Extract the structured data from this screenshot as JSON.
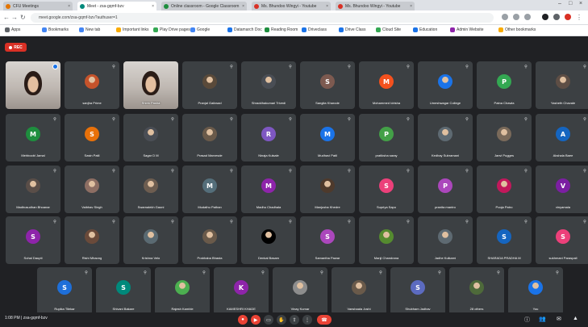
{
  "browser": {
    "tabs": [
      {
        "title": "CFU Meetings",
        "color": "#e37400",
        "active": false
      },
      {
        "title": "Meet - zsa-gqmf-bzv",
        "color": "#00897b",
        "active": true
      },
      {
        "title": "Online classroom - Google Classroom",
        "color": "#1e8e3e",
        "active": false
      },
      {
        "title": "Ms. Bhundoo Wingyi - Youtube",
        "color": "#d93025",
        "active": false
      },
      {
        "title": "Ms. Bhundoo Wingyi - Youtube",
        "color": "#d93025",
        "active": false
      }
    ],
    "url": "meet.google.com/zsa-gqmf-bzv?authuser=1",
    "bookmarks": [
      {
        "label": "Apps",
        "color": "#5f6368"
      },
      {
        "label": "Bookmarks",
        "color": "#4285f4"
      },
      {
        "label": "New tab",
        "color": "#4285f4"
      },
      {
        "label": "Important links",
        "color": "#f9ab00"
      },
      {
        "label": "Play Drive pages",
        "color": "#34a853"
      },
      {
        "label": "Google",
        "color": "#4285f4"
      },
      {
        "label": "Datamarch Doc",
        "color": "#1a73e8"
      },
      {
        "label": "Reading Room",
        "color": "#1e8e3e"
      },
      {
        "label": "Driveclass",
        "color": "#1a73e8"
      },
      {
        "label": "Drive Class",
        "color": "#1a73e8"
      },
      {
        "label": "Cloud Site",
        "color": "#34a853"
      },
      {
        "label": "Education",
        "color": "#1a73e8"
      },
      {
        "label": "Admin Website",
        "color": "#8e24aa"
      },
      {
        "label": "Other bookmarks",
        "color": "#f9ab00"
      }
    ]
  },
  "meet": {
    "recording_label": "REC",
    "participants": [
      {
        "name": "",
        "avatar": "video",
        "avatar_letter": "",
        "avatar_color": "",
        "pinned": true
      },
      {
        "name": "sanjha Prime",
        "avatar": "photo",
        "avatar_letter": "",
        "avatar_color": "#c5532b"
      },
      {
        "name": "Shirin Pasha",
        "avatar": "video",
        "avatar_letter": "",
        "avatar_color": ""
      },
      {
        "name": "Pranjal Gaikwad",
        "avatar": "photo",
        "avatar_letter": "",
        "avatar_color": "#5a4a3a"
      },
      {
        "name": "Shraddhakumari Trivedi",
        "avatar": "photo",
        "avatar_letter": "",
        "avatar_color": "#4a4e55"
      },
      {
        "name": "Sangita Kharode",
        "avatar": "letter",
        "avatar_letter": "S",
        "avatar_color": "#7d5a50"
      },
      {
        "name": "Mohammed Idrisha",
        "avatar": "letter",
        "avatar_letter": "M",
        "avatar_color": "#f4511e"
      },
      {
        "name": "Umeshwagar College",
        "avatar": "photo",
        "avatar_letter": "",
        "avatar_color": "#1a73e8"
      },
      {
        "name": "Patna Chawla",
        "avatar": "letter",
        "avatar_letter": "P",
        "avatar_color": "#33a852"
      },
      {
        "name": "Yasheth Chavale",
        "avatar": "photo",
        "avatar_letter": "",
        "avatar_color": "#5e4e45"
      },
      {
        "name": "Mehboobi Jamal",
        "avatar": "letter",
        "avatar_letter": "M",
        "avatar_color": "#1e8e3e"
      },
      {
        "name": "Sasin Patil",
        "avatar": "letter",
        "avatar_letter": "S",
        "avatar_color": "#e8710a"
      },
      {
        "name": "Sagar D M",
        "avatar": "photo",
        "avatar_letter": "",
        "avatar_color": "#4a4e55"
      },
      {
        "name": "Prasad Marvesde",
        "avatar": "photo",
        "avatar_letter": "",
        "avatar_color": "#6a5a4a"
      },
      {
        "name": "Ninaja Kulsale",
        "avatar": "letter",
        "avatar_letter": "R",
        "avatar_color": "#7e57c2"
      },
      {
        "name": "Mudhavi Patil",
        "avatar": "letter",
        "avatar_letter": "M",
        "avatar_color": "#1a73e8"
      },
      {
        "name": "pratiksha saray",
        "avatar": "letter",
        "avatar_letter": "P",
        "avatar_color": "#43a047"
      },
      {
        "name": "Kedhay Subramani",
        "avatar": "photo",
        "avatar_letter": "",
        "avatar_color": "#5e6a72"
      },
      {
        "name": "Janvi Pugges",
        "avatar": "photo",
        "avatar_letter": "",
        "avatar_color": "#7a6a5a"
      },
      {
        "name": "Akshala Baee",
        "avatar": "letter",
        "avatar_letter": "A",
        "avatar_color": "#1565c0"
      },
      {
        "name": "Madhusudhan Bhoanar",
        "avatar": "photo",
        "avatar_letter": "",
        "avatar_color": "#5a4e48"
      },
      {
        "name": "Vaibhav Singh",
        "avatar": "photo",
        "avatar_letter": "",
        "avatar_color": "#8d6e63"
      },
      {
        "name": "Swarnalekh Gaoni",
        "avatar": "photo",
        "avatar_letter": "",
        "avatar_color": "#6d5d50"
      },
      {
        "name": "Mudathu Pathan",
        "avatar": "letter",
        "avatar_letter": "M",
        "avatar_color": "#546e7a"
      },
      {
        "name": "Madhu Chadhala",
        "avatar": "letter",
        "avatar_letter": "M",
        "avatar_color": "#8e24aa"
      },
      {
        "name": "Manjusha Khedre",
        "avatar": "photo",
        "avatar_letter": "",
        "avatar_color": "#4e3a2c"
      },
      {
        "name": "Supriya Sapo",
        "avatar": "letter",
        "avatar_letter": "S",
        "avatar_color": "#ec407a"
      },
      {
        "name": "pranita mantro",
        "avatar": "letter",
        "avatar_letter": "P",
        "avatar_color": "#ab47bc"
      },
      {
        "name": "Pooja Patro",
        "avatar": "photo",
        "avatar_letter": "",
        "avatar_color": "#c2185b"
      },
      {
        "name": "vinyamala",
        "avatar": "letter",
        "avatar_letter": "V",
        "avatar_color": "#7b1fa2"
      },
      {
        "name": "Sohal Daupti",
        "avatar": "letter",
        "avatar_letter": "S",
        "avatar_color": "#8e24aa"
      },
      {
        "name": "Rishi Mhaong",
        "avatar": "photo",
        "avatar_letter": "",
        "avatar_color": "#6a4a3a"
      },
      {
        "name": "Krishna Velo",
        "avatar": "photo",
        "avatar_letter": "",
        "avatar_color": "#5a6a72"
      },
      {
        "name": "Prabhaba Bhasta",
        "avatar": "photo",
        "avatar_letter": "",
        "avatar_color": "#6a5a4a"
      },
      {
        "name": "Denkal Basam",
        "avatar": "photo",
        "avatar_letter": "",
        "avatar_color": "#000000"
      },
      {
        "name": "Samantha Pawar",
        "avatar": "letter",
        "avatar_letter": "S",
        "avatar_color": "#ab47bc"
      },
      {
        "name": "Manji Chandrana",
        "avatar": "photo",
        "avatar_letter": "",
        "avatar_color": "#558b2f"
      },
      {
        "name": "Jadhe Kulkarni",
        "avatar": "photo",
        "avatar_letter": "",
        "avatar_color": "#5e6a72"
      },
      {
        "name": "SHARADA PRADHA M",
        "avatar": "letter",
        "avatar_letter": "S",
        "avatar_color": "#1565c0"
      },
      {
        "name": "sukhmani Paraspali",
        "avatar": "letter",
        "avatar_letter": "S",
        "avatar_color": "#ec407a"
      },
      {
        "name": "Rupika Tilekar",
        "avatar": "letter",
        "avatar_letter": "S",
        "avatar_color": "#1e6fd9"
      },
      {
        "name": "Shivani Bakare",
        "avatar": "letter",
        "avatar_letter": "S",
        "avatar_color": "#00897b"
      },
      {
        "name": "Rajesh Kamble",
        "avatar": "photo",
        "avatar_letter": "",
        "avatar_color": "#4caf50"
      },
      {
        "name": "KAMESHRI KHADE",
        "avatar": "letter",
        "avatar_letter": "K",
        "avatar_color": "#8e24aa"
      },
      {
        "name": "Vinay Kumar",
        "avatar": "photo",
        "avatar_letter": "",
        "avatar_color": "#8d8d8d"
      },
      {
        "name": "Vanshaala Joshi",
        "avatar": "photo",
        "avatar_letter": "",
        "avatar_color": "#6a5a4a"
      },
      {
        "name": "Shubham Jadhav",
        "avatar": "letter",
        "avatar_letter": "S",
        "avatar_color": "#5c6bc0"
      },
      {
        "name": "28 others",
        "avatar": "photo",
        "avatar_letter": "",
        "avatar_color": "#4e6a3a"
      },
      {
        "name": "You",
        "avatar": "photo",
        "avatar_letter": "",
        "avatar_color": "#1a73e8"
      }
    ],
    "meeting_info": "1:08 PM | zsa-gqmf-bzv"
  }
}
